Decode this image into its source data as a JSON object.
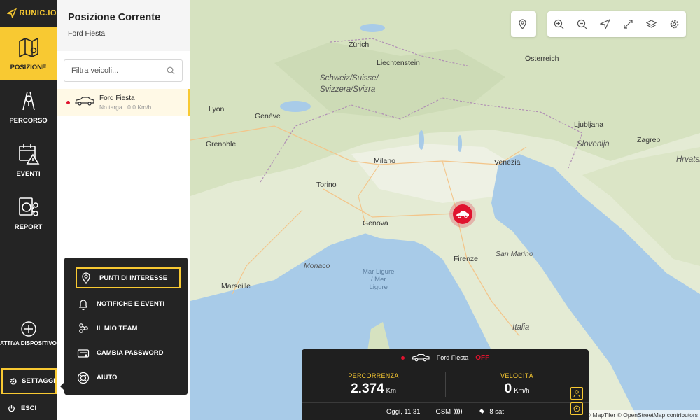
{
  "brand": {
    "name": "RUNIC.IO",
    "accent": "#f8c932",
    "alert": "#e0132e"
  },
  "sidebar": {
    "items": [
      {
        "label": "POSIZIONE",
        "icon": "map-icon",
        "active": true
      },
      {
        "label": "PERCORSO",
        "icon": "route-icon"
      },
      {
        "label": "EVENTI",
        "icon": "calendar-alert-icon"
      },
      {
        "label": "REPORT",
        "icon": "report-icon"
      }
    ],
    "add_device": "ATTIVA DISPOSITIVO",
    "settings": "SETTAGGI",
    "logout": "ESCI"
  },
  "panel": {
    "title": "Posizione Corrente",
    "subtitle": "Ford Fiesta",
    "search_placeholder": "Filtra veicoli...",
    "vehicles": [
      {
        "name": "Ford Fiesta",
        "meta": "No targa · 0.0 Km/h",
        "status_color": "#e0132e"
      }
    ]
  },
  "settings_menu": {
    "items": [
      {
        "label": "PUNTI DI INTERESSE",
        "icon": "pin-icon",
        "highlighted": true
      },
      {
        "label": "NOTIFICHE E EVENTI",
        "icon": "bell-icon"
      },
      {
        "label": "IL MIO TEAM",
        "icon": "team-icon"
      },
      {
        "label": "CAMBIA PASSWORD",
        "icon": "password-icon"
      },
      {
        "label": "AIUTO",
        "icon": "lifebuoy-icon"
      }
    ]
  },
  "map": {
    "labels": {
      "osterreich": "Österreich",
      "zurich": "Zürich",
      "liechtenstein": "Liechtenstein",
      "schweiz": "Schweiz/Suisse/",
      "svizzera": "Svizzera/Svizra",
      "geneve": "Genève",
      "lyon": "Lyon",
      "grenoble": "Grenoble",
      "milano": "Milano",
      "torino": "Torino",
      "genova": "Genova",
      "venezia": "Venezia",
      "ljubljana": "Ljubljana",
      "slovenija": "Slovenija",
      "zagreb": "Zagreb",
      "hrvatska": "Hrvatsk",
      "sanmarino": "San Marino",
      "firenze": "Firenze",
      "monaco": "Monaco",
      "marseille": "Marseille",
      "italia": "Italia",
      "mar_ligure_1": "Mar Ligure",
      "mar_ligure_2": "/ Mer",
      "mar_ligure_3": "Ligure"
    },
    "attribution": "© MapTiler © OpenStreetMap contributors",
    "tools": [
      "location-pin-icon",
      "zoom-in-icon",
      "zoom-out-icon",
      "navigate-icon",
      "fullscreen-icon",
      "layers-icon",
      "gear-icon"
    ]
  },
  "status_card": {
    "vehicle": "Ford Fiesta",
    "engine": "OFF",
    "distance_label": "PERCORRENZA",
    "distance_value": "2.374",
    "distance_unit": "Km",
    "speed_label": "VELOCITÀ",
    "speed_value": "0",
    "speed_unit": "Km/h",
    "time": "Oggi, 11:31",
    "gsm": "GSM",
    "satellites": "8 sat"
  }
}
